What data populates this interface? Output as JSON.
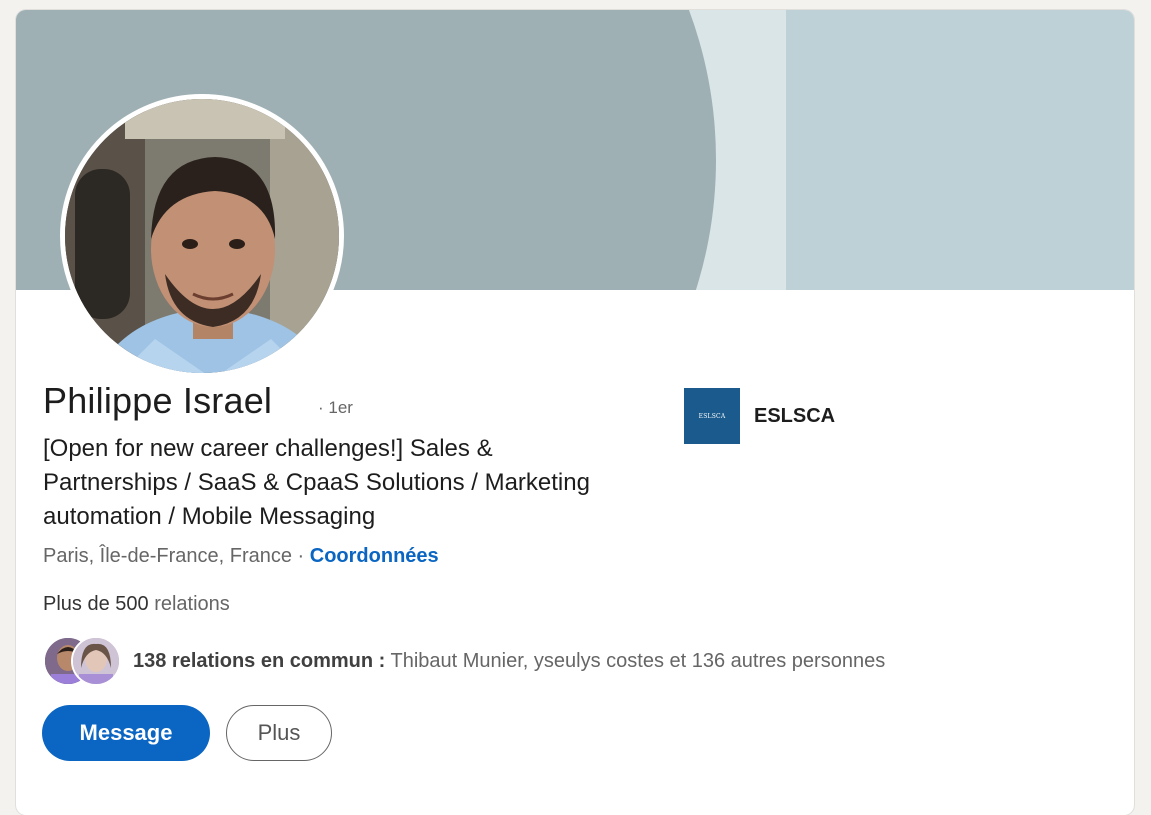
{
  "profile": {
    "name": "Philippe Israel",
    "degree": "· 1er",
    "headline": "[Open for new career challenges!] Sales & Partnerships / SaaS & CpaaS Solutions / Marketing automation / Mobile Messaging",
    "location": "Paris, Île-de-France, France",
    "location_separator": " · ",
    "contact_link": "Coordonnées",
    "connections_count": "Plus de 500",
    "connections_label": " relations",
    "mutual_count": "138 relations en commun :",
    "mutual_names": " Thibaut Munier, yseulys costes et 136 autres personnes"
  },
  "actions": {
    "message_label": "Message",
    "more_label": "Plus"
  },
  "education": {
    "school_name": "ESLSCA",
    "logo_text": "ESLSCA"
  },
  "colors": {
    "accent": "#0a66c2",
    "banner": "#9fb0b4",
    "school_logo": "#1a5a8c"
  }
}
